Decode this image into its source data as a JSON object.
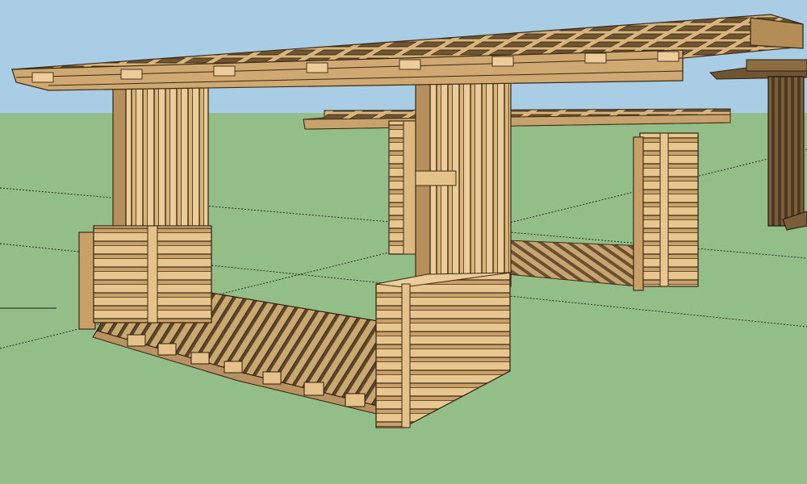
{
  "scene": {
    "kind": "3d-model-viewport",
    "subject": "wooden-pallet-pavilion",
    "colors": {
      "sky": "#a9cde5",
      "ground": "#93be88",
      "wood_light": "#e9c995",
      "wood_mid": "#d1ad74",
      "wood_dark": "#9a7747",
      "edge": "#3b2a14",
      "shadow": "#5a3f20",
      "far_wood": "#6b5334",
      "axis_line": "#1b1b1b"
    }
  }
}
